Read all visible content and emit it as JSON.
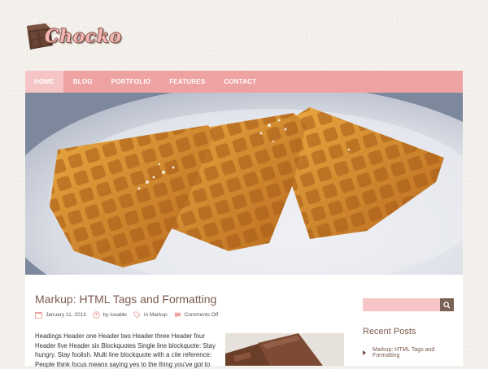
{
  "site": {
    "logo_text": "Chocko"
  },
  "nav": {
    "items": [
      {
        "label": "HOME",
        "active": true
      },
      {
        "label": "BLOG"
      },
      {
        "label": "PORTFOLIO"
      },
      {
        "label": "FEATURES"
      },
      {
        "label": "CONTACT"
      }
    ]
  },
  "post": {
    "title": "Markup: HTML Tags and Formatting",
    "date": "January 11, 2013",
    "author": "by iceable",
    "category": "in Markup",
    "comments": "Comments Off",
    "excerpt": "Headings Header one Header two Header three Header four Header five Header six Blockquotes Single line blockquote: Stay hungry. Stay foolish. Multi line blockquote with a cite reference: People think focus means saying yes to the thing you've got to"
  },
  "sidebar": {
    "search_placeholder": "",
    "recent_title": "Recent Posts",
    "recent_items": [
      "Markup: HTML Tags and Formatting"
    ]
  },
  "colors": {
    "nav_bg": "#eea2a2",
    "nav_active": "#f5c5c5",
    "title_brown": "#7b5a4c",
    "search_bg": "#f7c5c5",
    "search_btn": "#7a6355"
  }
}
